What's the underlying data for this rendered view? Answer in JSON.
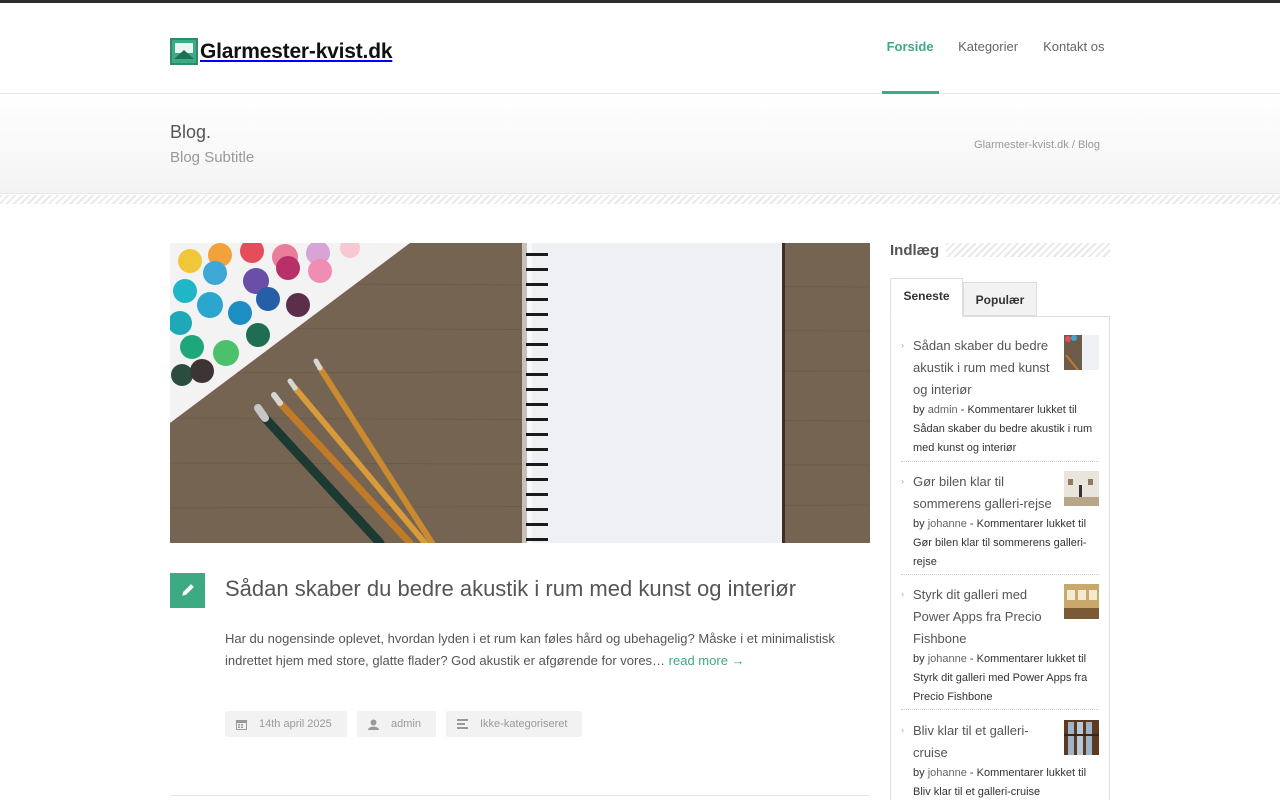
{
  "site": {
    "logo_text": "Glarmester-kvist.dk",
    "logo_icon": "image-icon"
  },
  "nav": [
    {
      "label": "Forside",
      "active": true
    },
    {
      "label": "Kategorier",
      "active": false
    },
    {
      "label": "Kontakt os",
      "active": false
    }
  ],
  "page": {
    "title": "Blog.",
    "subtitle": "Blog Subtitle",
    "breadcrumb": {
      "home": "Glarmester-kvist.dk",
      "separator": "/",
      "current": "Blog"
    }
  },
  "post": {
    "title": "Sådan skaber du bedre akustik i rum med kunst og interiør",
    "excerpt": "Har du nogensinde oplevet, hvordan lyden i et rum kan føles hård og ubehagelig? Måske i et minimalistisk indrettet hjem med store, glatte flader? God akustik er afgørende for vores…",
    "read_more": "read more →",
    "format_icon": "pencil-icon",
    "meta": {
      "date": "14th april 2025",
      "author": "admin",
      "category": "Ikke-kategoriseret"
    }
  },
  "sidebar": {
    "title": "Indlæg",
    "tabs": [
      {
        "label": "Seneste",
        "active": true
      },
      {
        "label": "Populær",
        "active": false
      }
    ],
    "items": [
      {
        "title": "Sådan skaber du bedre akustik i rum med kunst og interiør",
        "by": "by",
        "author": "admin",
        "meta": "- Kommentarer lukket til Sådan skaber du bedre akustik i rum med kunst og interiør"
      },
      {
        "title": "Gør bilen klar til sommerens galleri-rejse",
        "by": "by",
        "author": "johanne",
        "meta": "- Kommentarer lukket til Gør bilen klar til sommerens galleri-rejse"
      },
      {
        "title": "Styrk dit galleri med Power Apps fra Precio Fishbone",
        "by": "by",
        "author": "johanne",
        "meta": "- Kommentarer lukket til Styrk dit galleri med Power Apps fra Precio Fishbone"
      },
      {
        "title": "Bliv klar til et galleri-cruise",
        "by": "by",
        "author": "johanne",
        "meta": "- Kommentarer lukket til Bliv klar til et galleri-cruise"
      }
    ]
  },
  "colors": {
    "accent": "#3eaa83",
    "topbar": "#2b2b2b",
    "text": "#555555"
  }
}
